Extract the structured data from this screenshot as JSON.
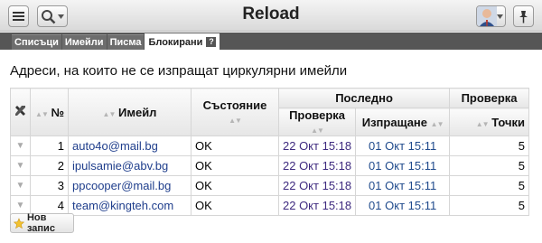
{
  "app": {
    "title": "Reload"
  },
  "tabs": [
    {
      "label": "Списъци"
    },
    {
      "label": "Имейли"
    },
    {
      "label": "Писма"
    },
    {
      "label": "Блокирани",
      "active": true
    }
  ],
  "help_label": "?",
  "heading": "Адреси, на които не се изпращат циркулярни имейли",
  "table": {
    "headers": {
      "num": "№",
      "email": "Имейл",
      "state": "Състояние",
      "last": "Последно",
      "check": "Проверка",
      "sent": "Изпращане",
      "verify": "Проверка",
      "points": "Точки"
    },
    "rows": [
      {
        "num": "1",
        "email": "auto4o@mail.bg",
        "state": "OK",
        "checked": "22 Окт 15:18",
        "sent": "01 Окт 15:11",
        "points": "5"
      },
      {
        "num": "2",
        "email": "ipulsamie@abv.bg",
        "state": "OK",
        "checked": "22 Окт 15:18",
        "sent": "01 Окт 15:11",
        "points": "5"
      },
      {
        "num": "3",
        "email": "ppcooper@mail.bg",
        "state": "OK",
        "checked": "22 Окт 15:18",
        "sent": "01 Окт 15:11",
        "points": "5"
      },
      {
        "num": "4",
        "email": "team@kingteh.com",
        "state": "OK",
        "checked": "22 Окт 15:18",
        "sent": "01 Окт 15:11",
        "points": "5"
      }
    ]
  },
  "new_button": "Нов запис",
  "icons": {
    "menu": "menu-icon",
    "search": "search-icon",
    "user": "user-avatar-icon",
    "pin": "pin-icon",
    "tools": "tools-icon",
    "star": "star-icon"
  },
  "colors": {
    "link": "#1f3e8c",
    "date_check": "#3e2a7f",
    "date_sent": "#1f4a8c",
    "tabbar": "#565656"
  }
}
